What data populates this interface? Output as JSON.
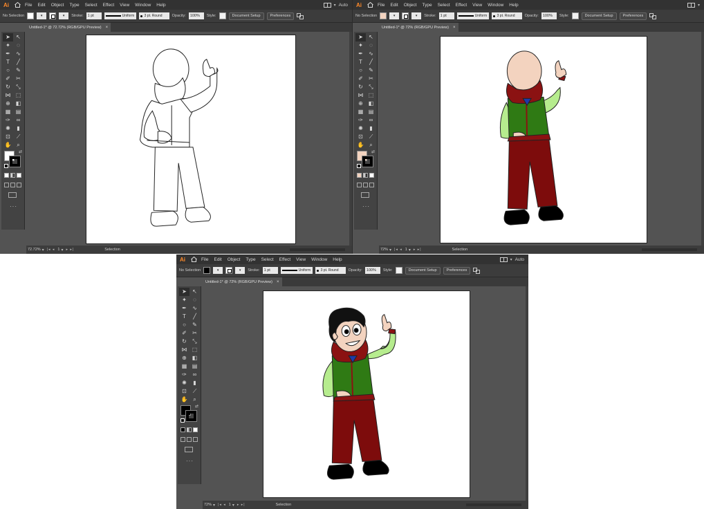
{
  "menu": {
    "logo": "Ai",
    "items": [
      "File",
      "Edit",
      "Object",
      "Type",
      "Select",
      "Effect",
      "View",
      "Window",
      "Help"
    ],
    "right_text": "Auto"
  },
  "control": {
    "selection": "No Selection",
    "stroke_label": "Stroke:",
    "stroke_weight": "1 pt",
    "profile": "Uniform",
    "brush": "3 pt. Round",
    "opacity_label": "Opacity:",
    "opacity_value": "100%",
    "style_label": "Style:",
    "doc_setup": "Document Setup",
    "preferences": "Preferences"
  },
  "windows": [
    {
      "tab_title": "Untitled-1* @ 72.72% (RGB/GPU Preview)",
      "zoom": "72.72%",
      "artboard_number": "1",
      "status_text": "Selection",
      "fill_color": "#ffffff",
      "stage": "outline"
    },
    {
      "tab_title": "Untitled-1* @ 72% (RGB/GPU Preview)",
      "zoom": "72%",
      "artboard_number": "1",
      "status_text": "Selection",
      "fill_color": "#f3d3bf",
      "stage": "colored"
    },
    {
      "tab_title": "Untitled-1* @ 72% (RGB/GPU Preview)",
      "zoom": "72%",
      "artboard_number": "1",
      "status_text": "Selection",
      "fill_color": "#000000",
      "stage": "final"
    }
  ],
  "tab_close_glyph": "×",
  "icons": {
    "home": "home-icon",
    "close": "close-icon",
    "swap": "swap-arrows-icon"
  },
  "palette": {
    "skin": "#f3d3bf",
    "scarf": "#8b1212",
    "vest": "#2f7a14",
    "sleeve": "#b6ec8e",
    "pants": "#7d0c0c",
    "shoes": "#000000",
    "collar": "#1e3aa8",
    "hair": "#111111"
  }
}
